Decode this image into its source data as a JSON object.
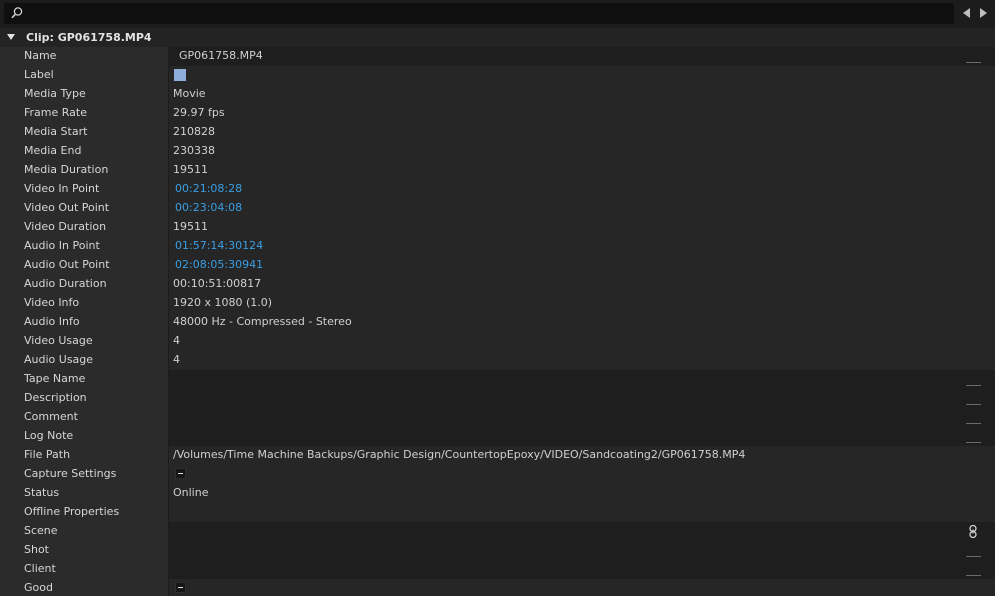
{
  "toolbar": {
    "search_placeholder": "",
    "prev_icon": "triangle-left-icon",
    "next_icon": "triangle-right-icon"
  },
  "section": {
    "title": "Clip: GP061758.MP4",
    "expanded": true
  },
  "colors": {
    "label_swatch": "#8eaedb",
    "timecode_link": "#3a9ee4"
  },
  "rows": [
    {
      "key": "name",
      "label": "Name",
      "value": "GP061758.MP4"
    },
    {
      "key": "label",
      "label": "Label",
      "value": ""
    },
    {
      "key": "media_type",
      "label": "Media Type",
      "value": "Movie"
    },
    {
      "key": "frame_rate",
      "label": "Frame Rate",
      "value": "29.97 fps"
    },
    {
      "key": "media_start",
      "label": "Media Start",
      "value": "210828"
    },
    {
      "key": "media_end",
      "label": "Media End",
      "value": "230338"
    },
    {
      "key": "media_duration",
      "label": "Media Duration",
      "value": "19511"
    },
    {
      "key": "video_in_point",
      "label": "Video In Point",
      "value": "00:21:08:28"
    },
    {
      "key": "video_out_point",
      "label": "Video Out Point",
      "value": "00:23:04:08"
    },
    {
      "key": "video_duration",
      "label": "Video Duration",
      "value": "19511"
    },
    {
      "key": "audio_in_point",
      "label": "Audio In Point",
      "value": "01:57:14:30124"
    },
    {
      "key": "audio_out_point",
      "label": "Audio Out Point",
      "value": "02:08:05:30941"
    },
    {
      "key": "audio_duration",
      "label": "Audio Duration",
      "value": "00:10:51:00817"
    },
    {
      "key": "video_info",
      "label": "Video Info",
      "value": "1920 x 1080 (1.0)"
    },
    {
      "key": "audio_info",
      "label": "Audio Info",
      "value": "48000 Hz - Compressed - Stereo"
    },
    {
      "key": "video_usage",
      "label": "Video Usage",
      "value": "4"
    },
    {
      "key": "audio_usage",
      "label": "Audio Usage",
      "value": "4"
    },
    {
      "key": "tape_name",
      "label": "Tape Name",
      "value": ""
    },
    {
      "key": "description",
      "label": "Description",
      "value": ""
    },
    {
      "key": "comment",
      "label": "Comment",
      "value": ""
    },
    {
      "key": "log_note",
      "label": "Log Note",
      "value": ""
    },
    {
      "key": "file_path",
      "label": "File Path",
      "value": "/Volumes/Time Machine Backups/Graphic Design/CountertopEpoxy/VIDEO/Sandcoating2/GP061758.MP4"
    },
    {
      "key": "capture_settings",
      "label": "Capture Settings",
      "value": ""
    },
    {
      "key": "status",
      "label": "Status",
      "value": "Online"
    },
    {
      "key": "offline_properties",
      "label": "Offline Properties",
      "value": ""
    },
    {
      "key": "scene",
      "label": "Scene",
      "value": ""
    },
    {
      "key": "shot",
      "label": "Shot",
      "value": ""
    },
    {
      "key": "client",
      "label": "Client",
      "value": ""
    },
    {
      "key": "good",
      "label": "Good",
      "value": ""
    }
  ]
}
